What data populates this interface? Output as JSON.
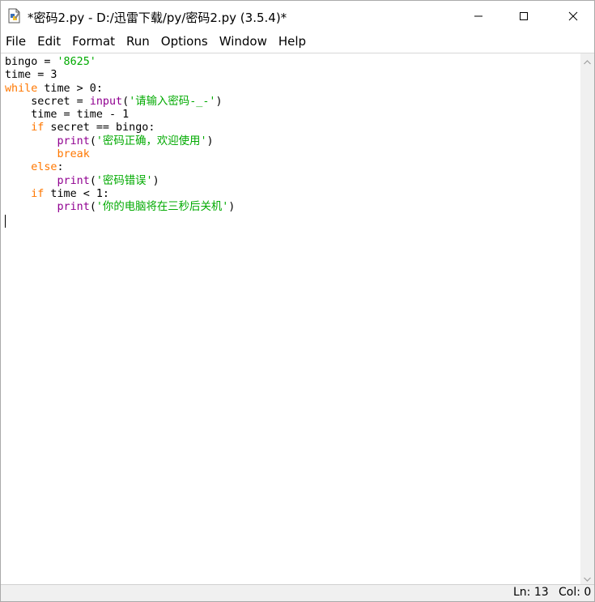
{
  "window": {
    "title": "*密码2.py - D:/迅雷下载/py/密码2.py (3.5.4)*",
    "app_icon": "idle-document-icon",
    "controls": {
      "minimize_icon": "minimize-icon",
      "maximize_icon": "maximize-icon",
      "close_icon": "close-icon"
    }
  },
  "menu": {
    "items": [
      "File",
      "Edit",
      "Format",
      "Run",
      "Options",
      "Window",
      "Help"
    ]
  },
  "editor": {
    "lines": [
      [
        {
          "t": "bingo = "
        },
        {
          "t": "'8625'",
          "c": "st"
        }
      ],
      [
        {
          "t": "time = 3"
        }
      ],
      [
        {
          "t": "while",
          "c": "kw"
        },
        {
          "t": " time > 0:"
        }
      ],
      [
        {
          "t": "    secret = "
        },
        {
          "t": "input",
          "c": "bi"
        },
        {
          "t": "("
        },
        {
          "t": "'请输入密码-_-'",
          "c": "st"
        },
        {
          "t": ")"
        }
      ],
      [
        {
          "t": "    time = time - 1"
        }
      ],
      [
        {
          "t": "    "
        },
        {
          "t": "if",
          "c": "kw"
        },
        {
          "t": " secret == bingo:"
        }
      ],
      [
        {
          "t": "        "
        },
        {
          "t": "print",
          "c": "bi"
        },
        {
          "t": "("
        },
        {
          "t": "'密码正确，欢迎使用'",
          "c": "st"
        },
        {
          "t": ")"
        }
      ],
      [
        {
          "t": "        "
        },
        {
          "t": "break",
          "c": "kw"
        }
      ],
      [
        {
          "t": "    "
        },
        {
          "t": "else",
          "c": "kw"
        },
        {
          "t": ":"
        }
      ],
      [
        {
          "t": "        "
        },
        {
          "t": "print",
          "c": "bi"
        },
        {
          "t": "("
        },
        {
          "t": "'密码错误'",
          "c": "st"
        },
        {
          "t": ")"
        }
      ],
      [
        {
          "t": "    "
        },
        {
          "t": "if",
          "c": "kw"
        },
        {
          "t": " time < 1:"
        }
      ],
      [
        {
          "t": "        "
        },
        {
          "t": "print",
          "c": "bi"
        },
        {
          "t": "("
        },
        {
          "t": "'你的电脑将在三秒后关机'",
          "c": "st"
        },
        {
          "t": ")"
        }
      ],
      [
        {
          "t": ""
        }
      ]
    ],
    "colors": {
      "keyword": "#ff7700",
      "builtin": "#900090",
      "string": "#00aa00",
      "default": "#000000"
    }
  },
  "scrollbar": {
    "up_icon": "scroll-up-arrow-icon",
    "down_icon": "scroll-down-arrow-icon"
  },
  "status": {
    "line": "Ln: 13",
    "col": "Col: 0"
  }
}
